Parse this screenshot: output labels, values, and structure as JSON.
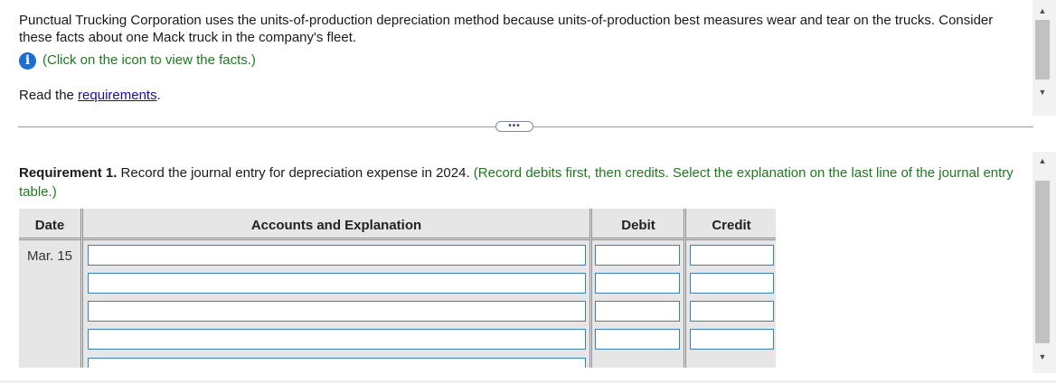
{
  "intro": {
    "text": "Punctual Trucking Corporation uses the units-of-production depreciation method because units-of-production best measures wear and tear on the trucks. Consider these facts about one Mack truck in the company's fleet.",
    "info_text": "(Click on the icon to view the facts.)",
    "read_prefix": "Read the ",
    "read_link": "requirements",
    "read_suffix": "."
  },
  "divider_handle": "•••",
  "requirement": {
    "label": "Requirement 1.",
    "text": " Record the journal entry for depreciation expense in 2024. ",
    "instruction": "(Record debits first, then credits. Select the explanation on the last line of the journal entry table.)"
  },
  "journal": {
    "headers": {
      "date": "Date",
      "accounts": "Accounts and Explanation",
      "debit": "Debit",
      "credit": "Credit"
    },
    "date_value": "Mar. 15"
  }
}
